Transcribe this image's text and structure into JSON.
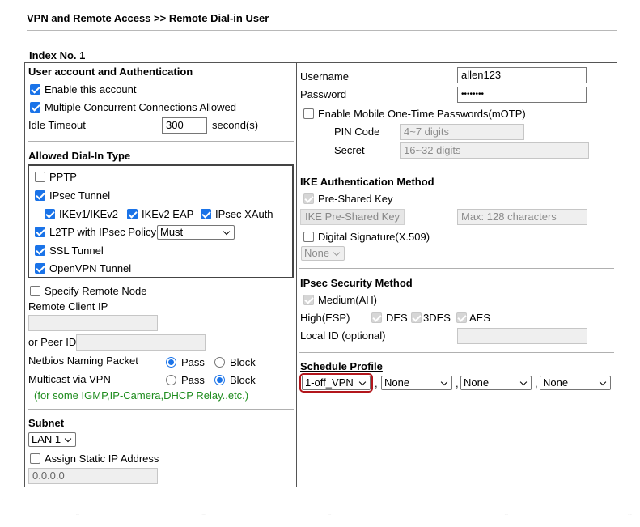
{
  "page": {
    "title": "VPN and Remote Access >> Remote Dial-in User",
    "index_label": "Index No. 1"
  },
  "left": {
    "auth_section": "User account and Authentication",
    "enable_account": "Enable this account",
    "multiple_connections": "Multiple Concurrent Connections Allowed",
    "idle_timeout_label": "Idle Timeout",
    "idle_timeout_value": "300",
    "idle_timeout_unit": "second(s)",
    "dialin_section": "Allowed Dial-In Type",
    "pptp": "PPTP",
    "ipsec_tunnel": "IPsec Tunnel",
    "ikev1": "IKEv1/IKEv2",
    "ikev2_eap": "IKEv2 EAP",
    "ipsec_xauth": "IPsec XAuth",
    "l2tp": "L2TP with IPsec Policy",
    "l2tp_policy": "Must",
    "ssl_tunnel": "SSL Tunnel",
    "openvpn": "OpenVPN Tunnel",
    "specify_remote": "Specify Remote Node",
    "remote_client_ip": "Remote Client IP",
    "peer_id": "or Peer ID",
    "netbios": "Netbios Naming Packet",
    "multicast": "Multicast via VPN",
    "pass": "Pass",
    "block": "Block",
    "multicast_note": "(for some IGMP,IP-Camera,DHCP Relay..etc.)",
    "subnet_section": "Subnet",
    "subnet_value": "LAN 1",
    "assign_static": "Assign Static IP Address",
    "static_ip": "0.0.0.0"
  },
  "right": {
    "username_label": "Username",
    "username_value": "allen123",
    "password_label": "Password",
    "password_value": "••••••••",
    "motp": "Enable Mobile One-Time Passwords(mOTP)",
    "pin_label": "PIN Code",
    "pin_placeholder": "4~7 digits",
    "secret_label": "Secret",
    "secret_placeholder": "16~32 digits",
    "ike_section": "IKE Authentication Method",
    "psk": "Pre-Shared Key",
    "ike_psk_button": "IKE Pre-Shared Key",
    "psk_placeholder": "Max: 128 characters",
    "digital_sig": "Digital Signature(X.509)",
    "cert_select": "None",
    "ipsec_section": "IPsec Security Method",
    "medium": "Medium(AH)",
    "high_esp": "High(ESP)",
    "des": "DES",
    "des3": "3DES",
    "aes": "AES",
    "local_id": "Local ID (optional)",
    "schedule_section": "Schedule Profile",
    "schedules": [
      "1-off_VPN",
      "None",
      "None",
      "None"
    ],
    "comma": ","
  },
  "colors": {
    "accent": "#1a73e8",
    "note_green": "#1e8c1e",
    "highlight_red": "#b3161c"
  }
}
